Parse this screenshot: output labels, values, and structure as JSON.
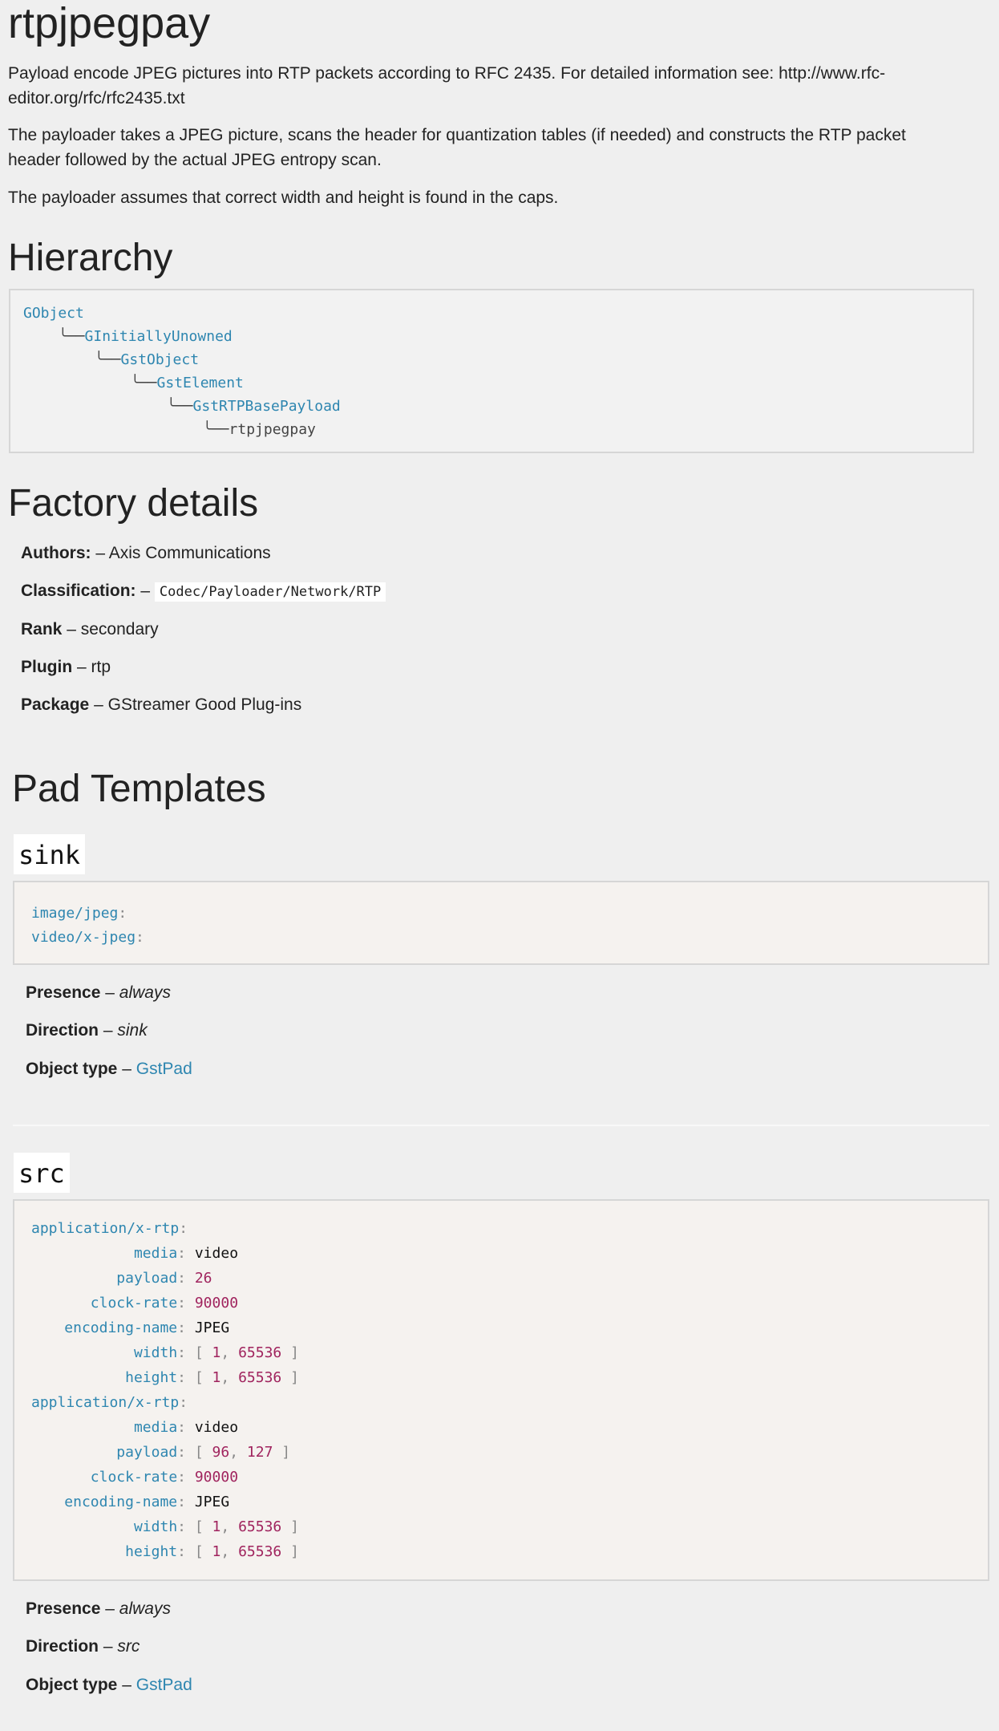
{
  "page": {
    "title": "rtpjpegpay",
    "intro": [
      "Payload encode JPEG pictures into RTP packets according to RFC 2435. For detailed information see: http://www.rfc-",
      "editor.org/rfc/rfc2435.txt"
    ],
    "para2": [
      "The payloader takes a JPEG picture, scans the header for quantization tables (if needed) and constructs the RTP packet",
      "header followed by the actual JPEG entropy scan."
    ],
    "para3": "The payloader assumes that correct width and height is found in the caps."
  },
  "hierarchy": {
    "heading": "Hierarchy",
    "items": [
      "GObject",
      "GInitiallyUnowned",
      "GstObject",
      "GstElement",
      "GstRTPBasePayload",
      "rtpjpegpay"
    ]
  },
  "factory": {
    "heading": "Factory details",
    "authors_label": "Authors:",
    "authors_value": "Axis Communications",
    "classification_label": "Classification:",
    "classification_value": "Codec/Payloader/Network/RTP",
    "rank_label": "Rank",
    "rank_value": "secondary",
    "plugin_label": "Plugin",
    "plugin_value": "rtp",
    "package_label": "Package",
    "package_value": "GStreamer Good Plug-ins",
    "dash": "–"
  },
  "pad_templates": {
    "heading": "Pad Templates",
    "sink": {
      "name": "sink",
      "caps": [
        "image/jpeg",
        "video/x-jpeg"
      ],
      "presence_label": "Presence",
      "presence_value": "always",
      "direction_label": "Direction",
      "direction_value": "sink",
      "object_type_label": "Object type",
      "object_type_value": "GstPad"
    },
    "src": {
      "name": "src",
      "caps": [
        {
          "type": "application/x-rtp",
          "fields": [
            {
              "key": "media",
              "value": "video"
            },
            {
              "key": "payload",
              "value": "26"
            },
            {
              "key": "clock-rate",
              "value": "90000"
            },
            {
              "key": "encoding-name",
              "value": "JPEG"
            },
            {
              "key": "width",
              "range": [
                "1",
                "65536"
              ]
            },
            {
              "key": "height",
              "range": [
                "1",
                "65536"
              ]
            }
          ]
        },
        {
          "type": "application/x-rtp",
          "fields": [
            {
              "key": "media",
              "value": "video"
            },
            {
              "key": "payload",
              "range": [
                "96",
                "127"
              ]
            },
            {
              "key": "clock-rate",
              "value": "90000"
            },
            {
              "key": "encoding-name",
              "value": "JPEG"
            },
            {
              "key": "width",
              "range": [
                "1",
                "65536"
              ]
            },
            {
              "key": "height",
              "range": [
                "1",
                "65536"
              ]
            }
          ]
        }
      ],
      "presence_label": "Presence",
      "presence_value": "always",
      "direction_label": "Direction",
      "direction_value": "src",
      "object_type_label": "Object type",
      "object_type_value": "GstPad"
    }
  },
  "colors": {
    "background": "#efefef",
    "link": "#2e86b0",
    "number": "#a0245e"
  }
}
